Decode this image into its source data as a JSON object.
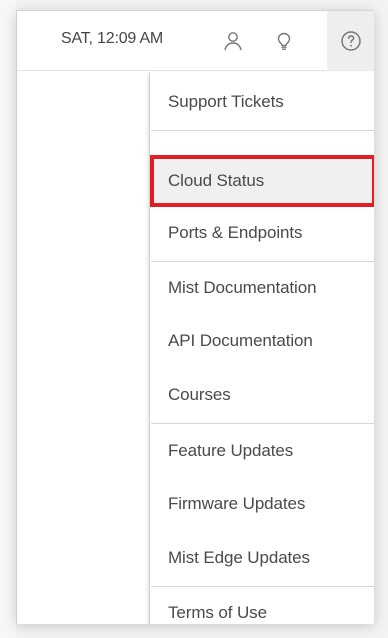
{
  "topbar": {
    "datetime": "SAT, 12:09 AM",
    "icons": {
      "user": "user-icon",
      "tips": "lightbulb-icon",
      "help": "help-icon"
    }
  },
  "help_menu": {
    "items": [
      {
        "label": "Support Tickets"
      },
      {
        "label": "Cloud Status",
        "selected": true
      },
      {
        "label": "Ports & Endpoints"
      },
      {
        "label": "Mist Documentation"
      },
      {
        "label": "API Documentation"
      },
      {
        "label": "Courses"
      },
      {
        "label": "Feature Updates"
      },
      {
        "label": "Firmware Updates"
      },
      {
        "label": "Mist Edge Updates"
      },
      {
        "label": "Terms of Use"
      }
    ]
  },
  "colors": {
    "highlight": "#e21d24",
    "text": "#4a4a4a",
    "selected_bg": "#f0f0f0"
  }
}
